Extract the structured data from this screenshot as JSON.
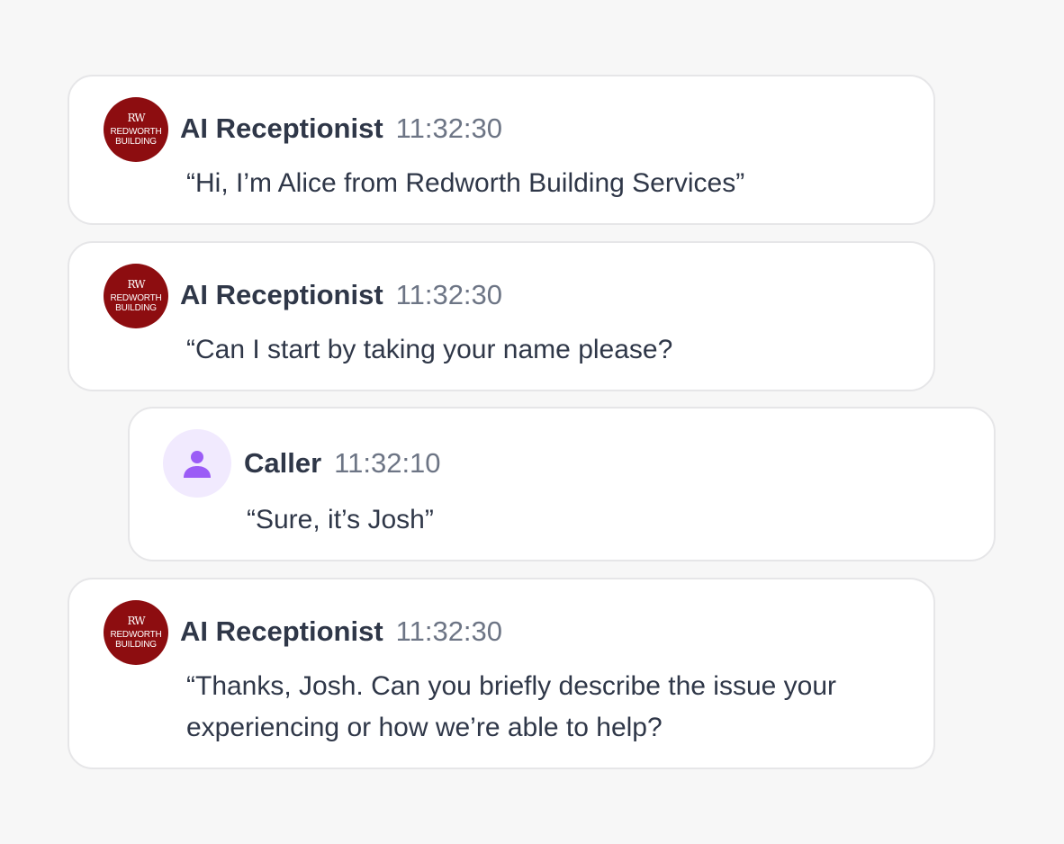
{
  "brand": {
    "mark": "RW",
    "line1": "REDWORTH",
    "line2": "BUILDING",
    "color": "#8d0d10"
  },
  "caller_accent": "#9b5cf6",
  "messages": [
    {
      "speaker": "AI Receptionist",
      "time": "11:32:30",
      "text": "“Hi, I’m Alice from Redworth Building Services”",
      "avatar": "redworth-logo"
    },
    {
      "speaker": "AI Receptionist",
      "time": "11:32:30",
      "text": "“Can I start by taking your name please?",
      "avatar": "redworth-logo"
    },
    {
      "speaker": "Caller",
      "time": "11:32:10",
      "text": "“Sure, it’s Josh”",
      "avatar": "person-icon"
    },
    {
      "speaker": "AI Receptionist",
      "time": "11:32:30",
      "text": "“Thanks, Josh. Can you briefly describe the issue your experiencing or how we’re able to help?",
      "avatar": "redworth-logo"
    }
  ]
}
